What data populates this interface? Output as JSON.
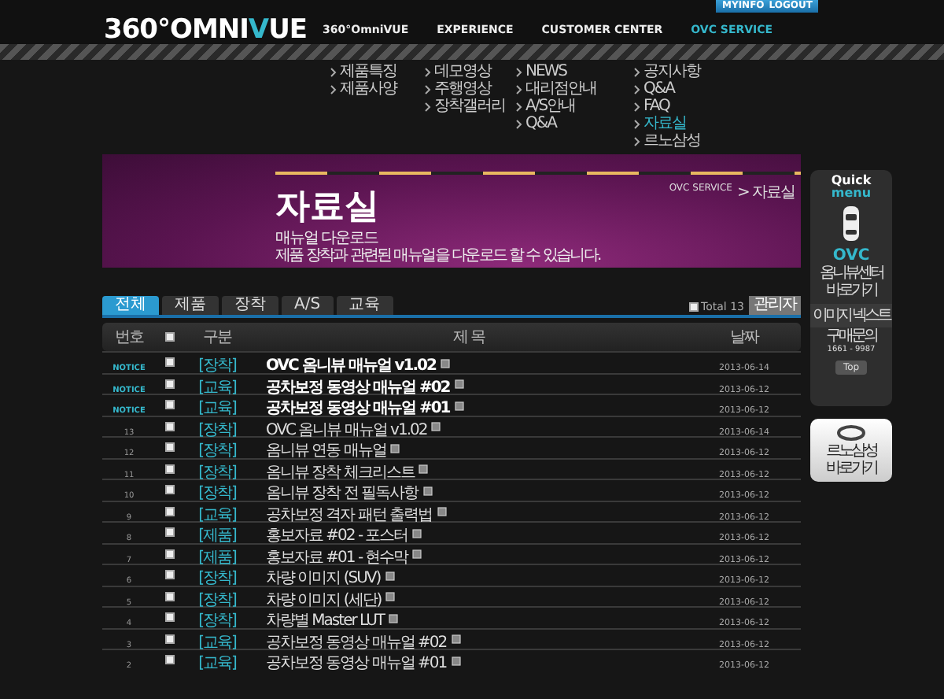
{
  "top_links": [
    "MYINFO",
    "LOGOUT"
  ],
  "logo": [
    {
      "text": "360°OMNI",
      "accent": false
    },
    {
      "text": "V",
      "accent": true
    },
    {
      "text": "UE",
      "accent": false
    }
  ],
  "nav": [
    {
      "label": "360°OmniVUE",
      "selected": false,
      "submenu": [
        {
          "label": "제품특징",
          "selected": false
        },
        {
          "label": "제품사양",
          "selected": false
        }
      ]
    },
    {
      "label": "EXPERIENCE",
      "selected": false,
      "submenu": [
        {
          "label": "데모영상",
          "selected": false
        },
        {
          "label": "주행영상",
          "selected": false
        },
        {
          "label": "장착갤러리",
          "selected": false
        }
      ]
    },
    {
      "label": "CUSTOMER CENTER",
      "selected": false,
      "submenu": [
        {
          "label": "NEWS",
          "selected": false
        },
        {
          "label": "대리점안내",
          "selected": false
        },
        {
          "label": "A/S안내",
          "selected": false
        },
        {
          "label": "Q&A",
          "selected": false
        }
      ]
    },
    {
      "label": "OVC SERVICE",
      "selected": true,
      "submenu": [
        {
          "label": "공지사항",
          "selected": false
        },
        {
          "label": "Q&A",
          "selected": false
        },
        {
          "label": "FAQ",
          "selected": false
        },
        {
          "label": "자료실",
          "selected": true
        },
        {
          "label": "르노삼성",
          "selected": false
        }
      ]
    }
  ],
  "banner": {
    "title": "자료실",
    "breadcrumb": [
      "OVC SERVICE",
      "> 자료실"
    ],
    "subtitle": "매뉴얼 다운로드",
    "description": "제품 장착과 관련된 매뉴얼을 다운로드 할 수 있습니다."
  },
  "tabs": [
    {
      "label": "전체",
      "selected": true
    },
    {
      "label": "제품",
      "selected": false
    },
    {
      "label": "장착",
      "selected": false
    },
    {
      "label": "A/S",
      "selected": false
    },
    {
      "label": "교육",
      "selected": false
    }
  ],
  "select_all_checked": false,
  "total": "Total 13",
  "admin_button": "관리자",
  "table": {
    "columns": [
      "번호",
      "구분",
      "제 목",
      "날짜"
    ],
    "header_checked": false,
    "rows": [
      {
        "kind": "notice",
        "number": "NOTICE",
        "checked": false,
        "category": "[장착]",
        "title": "OVC 옴니뷰 매뉴얼 v1.02",
        "date": "2013-06-14"
      },
      {
        "kind": "notice",
        "number": "NOTICE",
        "checked": false,
        "category": "[교육]",
        "title": "공차보정 동영상 매뉴얼 #02",
        "date": "2013-06-12"
      },
      {
        "kind": "notice",
        "number": "NOTICE",
        "checked": false,
        "category": "[교육]",
        "title": "공차보정 동영상 매뉴얼 #01",
        "date": "2013-06-12"
      },
      {
        "kind": "post",
        "number": "13",
        "checked": false,
        "category": "[장착]",
        "title": "OVC 옴니뷰 매뉴얼 v1.02",
        "date": "2013-06-14"
      },
      {
        "kind": "post",
        "number": "12",
        "checked": false,
        "category": "[장착]",
        "title": "옴니뷰 연동 매뉴얼",
        "date": "2013-06-12"
      },
      {
        "kind": "post",
        "number": "11",
        "checked": false,
        "category": "[장착]",
        "title": "옴니뷰 장착 체크리스트",
        "date": "2013-06-12"
      },
      {
        "kind": "post",
        "number": "10",
        "checked": false,
        "category": "[장착]",
        "title": "옴니뷰 장착 전 필독사항",
        "date": "2013-06-12"
      },
      {
        "kind": "post",
        "number": "9",
        "checked": false,
        "category": "[교육]",
        "title": "공차보정 격자 패턴 출력법",
        "date": "2013-06-12"
      },
      {
        "kind": "post",
        "number": "8",
        "checked": false,
        "category": "[제품]",
        "title": "홍보자료 #02 - 포스터",
        "date": "2013-06-12"
      },
      {
        "kind": "post",
        "number": "7",
        "checked": false,
        "category": "[제품]",
        "title": "홍보자료 #01 - 현수막",
        "date": "2013-06-12"
      },
      {
        "kind": "post",
        "number": "6",
        "checked": false,
        "category": "[장착]",
        "title": "차량 이미지 (SUV)",
        "date": "2013-06-12"
      },
      {
        "kind": "post",
        "number": "5",
        "checked": false,
        "category": "[장착]",
        "title": "차량 이미지 (세단)",
        "date": "2013-06-12"
      },
      {
        "kind": "post",
        "number": "4",
        "checked": false,
        "category": "[장착]",
        "title": "차량별 Master LUT",
        "date": "2013-06-12"
      },
      {
        "kind": "post",
        "number": "3",
        "checked": false,
        "category": "[교육]",
        "title": "공차보정 동영상 매뉴얼 #02",
        "date": "2013-06-12"
      },
      {
        "kind": "post",
        "number": "2",
        "checked": false,
        "category": "[교육]",
        "title": "공차보정 동영상 매뉴얼 #01",
        "date": "2013-06-12"
      }
    ]
  },
  "quick_menu": {
    "title": [
      "Quick",
      "menu"
    ],
    "ovc": "OVC",
    "ovc_link": "옴니뷰센터 바로가기",
    "image_text": "이미지 넥스트",
    "contact_label": "구매문의",
    "phone": "1661 - 9987",
    "top": "Top"
  },
  "partner_link": "르노삼성 바로가기"
}
